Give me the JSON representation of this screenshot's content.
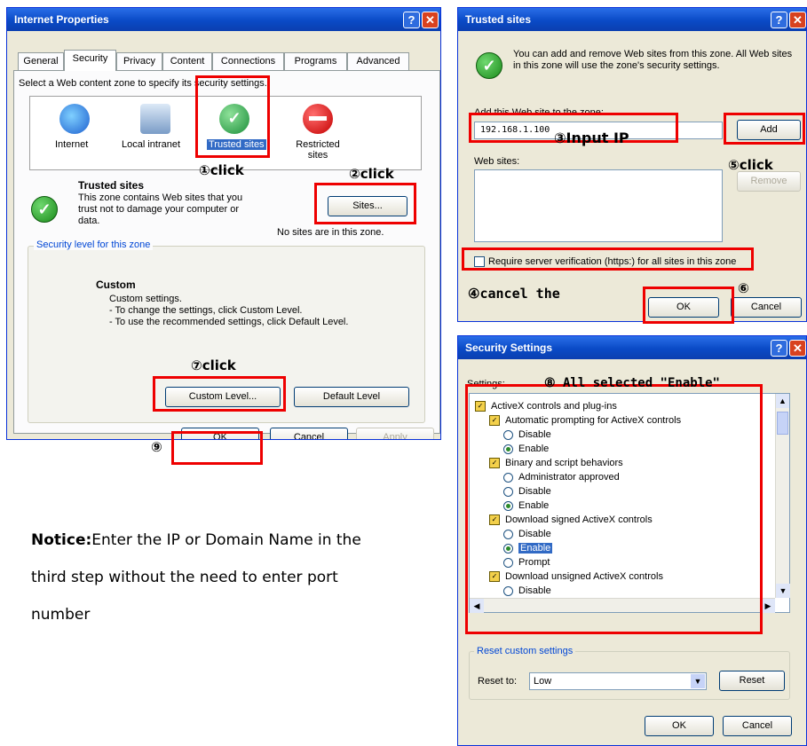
{
  "internet_properties": {
    "title": "Internet Properties",
    "tabs": [
      "General",
      "Security",
      "Privacy",
      "Content",
      "Connections",
      "Programs",
      "Advanced"
    ],
    "select_zone_text": "Select a Web content zone to specify its security settings.",
    "zones": [
      "Internet",
      "Local intranet",
      "Trusted sites",
      "Restricted sites"
    ],
    "zone_heading": "Trusted sites",
    "zone_desc_line1": "This zone contains Web sites that you",
    "zone_desc_line2": "trust not to damage your computer or",
    "zone_desc_line3": "data.",
    "sites_button": "Sites...",
    "no_sites": "No sites are in this zone.",
    "security_level_legend": "Security level for this zone",
    "custom_heading": "Custom",
    "custom_line1": "Custom settings.",
    "custom_line2": "- To change the settings, click Custom Level.",
    "custom_line3": "- To use the recommended settings, click Default Level.",
    "custom_level_button": "Custom Level...",
    "default_level_button": "Default Level",
    "ok_button": "OK",
    "cancel_button": "Cancel",
    "apply_button": "Apply",
    "help_glyph": "?",
    "close_glyph": "✕"
  },
  "trusted_sites": {
    "title": "Trusted sites",
    "intro_line1": "You can add and remove Web sites from this zone. All Web sites",
    "intro_line2": "in this zone will use the zone's security settings.",
    "add_label": "Add this Web site to the zone:",
    "ip_value": "192.168.1.100",
    "add_button": "Add",
    "web_sites_label": "Web sites:",
    "remove_button": "Remove",
    "require_https": "Require server verification (https:) for all sites in this zone",
    "ok_button": "OK",
    "cancel_button": "Cancel"
  },
  "security_settings": {
    "title": "Security Settings",
    "settings_label": "Settings:",
    "items": [
      {
        "text": "ActiveX controls and plug-ins",
        "level": 0,
        "type": "folder"
      },
      {
        "text": "Automatic prompting for ActiveX controls",
        "level": 1,
        "type": "folder"
      },
      {
        "text": "Disable",
        "level": 2,
        "type": "radio",
        "on": false
      },
      {
        "text": "Enable",
        "level": 2,
        "type": "radio",
        "on": true
      },
      {
        "text": "Binary and script behaviors",
        "level": 1,
        "type": "folder"
      },
      {
        "text": "Administrator approved",
        "level": 2,
        "type": "radio",
        "on": false
      },
      {
        "text": "Disable",
        "level": 2,
        "type": "radio",
        "on": false
      },
      {
        "text": "Enable",
        "level": 2,
        "type": "radio",
        "on": true
      },
      {
        "text": "Download signed ActiveX controls",
        "level": 1,
        "type": "folder"
      },
      {
        "text": "Disable",
        "level": 2,
        "type": "radio",
        "on": false
      },
      {
        "text": "Enable",
        "level": 2,
        "type": "radio",
        "on": true,
        "selected": true
      },
      {
        "text": "Prompt",
        "level": 2,
        "type": "radio",
        "on": false
      },
      {
        "text": "Download unsigned ActiveX controls",
        "level": 1,
        "type": "folder"
      },
      {
        "text": "Disable",
        "level": 2,
        "type": "radio",
        "on": false
      }
    ],
    "reset_legend": "Reset custom settings",
    "reset_to_label": "Reset to:",
    "reset_to_value": "Low",
    "reset_button": "Reset",
    "ok_button": "OK",
    "cancel_button": "Cancel"
  },
  "annotations": {
    "a1": "①click",
    "a2": "②click",
    "a3": "③Input IP",
    "a4": "④cancel the",
    "a5": "⑤click",
    "a6": "⑥",
    "a7": "⑦click",
    "a8": "⑧ All selected \"Enable\"",
    "a9": "⑨"
  },
  "notice": {
    "label": "Notice:",
    "line1": "Enter the IP or Domain Name in the",
    "line2": "third step without the need to enter port",
    "line3": "number"
  }
}
